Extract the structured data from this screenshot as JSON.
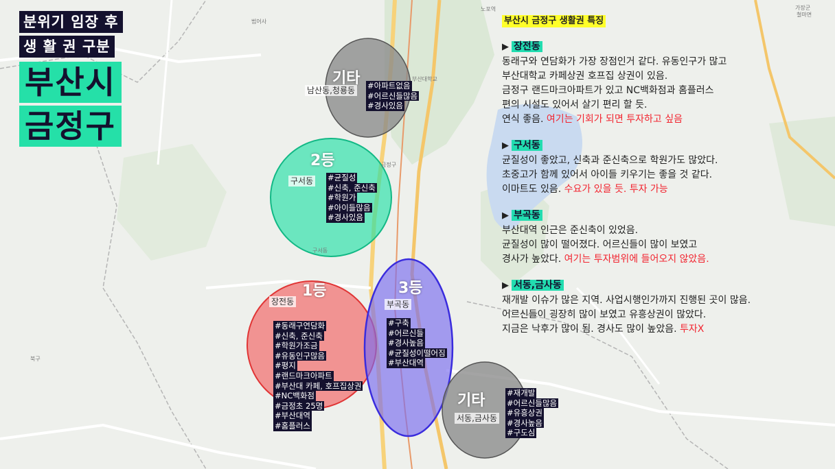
{
  "colors": {
    "title_bg": "#14112e",
    "title_big_bg": "#25e0a8",
    "grade_etc": "#8a8a8a",
    "grade_2": "#25e0a8",
    "grade_1": "#f25a5a",
    "grade_3": "#7a6cf0",
    "highlight": "#ffff2a",
    "section_bg": "#22ddb0",
    "accent_red": "#f2242f"
  },
  "title": {
    "line1": "분위기 임장 후",
    "line2": "생 활 권 구분",
    "big1": "부산시",
    "big2": "금정구"
  },
  "map_labels": {
    "l1": "범어사",
    "l2": "노포역",
    "l3": "가장군",
    "l4": "철마면",
    "l5": "금정구",
    "l6": "서동",
    "l7": "북구",
    "l8": "부산대학교",
    "l9": "청룡동",
    "l10": "구서동"
  },
  "zones": [
    {
      "rank": "기타",
      "area": "남산동,청룡동",
      "tags": [
        "#아파트없음",
        "#어르신들많음",
        "#경사있음"
      ]
    },
    {
      "rank": "2등",
      "area": "구서동",
      "tags": [
        "#균질성",
        "#신축, 준신축",
        "#학원가",
        "#아이들많음",
        "#경사있음"
      ]
    },
    {
      "rank": "1등",
      "area": "장전동",
      "tags": [
        "#동래구연담화",
        "#신축, 준신축",
        "#학원가조금",
        "#유동인구많음",
        "#평지",
        "#랜드마크아파트",
        "#부산대 카페, 호프집상권",
        "#NC백화점",
        "#금정초 25명",
        "#부산대역",
        "#홈플러스"
      ]
    },
    {
      "rank": "3등",
      "area": "부곡동",
      "tags": [
        "#구축",
        "#어르신들",
        "#경사높음",
        "#균질성이떨어짐",
        "#부산대역"
      ]
    },
    {
      "rank": "기타",
      "area": "서동,금사동",
      "tags": [
        "#재개발",
        "#어르신들많음",
        "#유흥상권",
        "#경사높음",
        "#구도심"
      ]
    }
  ],
  "panel": {
    "title": "부산시 금정구 생활권 특징",
    "arrow": "▶",
    "sections": [
      {
        "name": "장전동",
        "lines": [
          "동래구와 연담화가 가장 장점인거 같다. 유동인구가 많고",
          "부산대학교 카페상권 호프집 상권이 있음.",
          "금정구 랜드마크아파트가 있고 NC백화점과 홈플러스",
          "편의 시설도 있어서 살기 편리 할 듯."
        ],
        "last_normal": "연식 좋음. ",
        "last_accent": "여기는 기회가 되면 투자하고 싶음"
      },
      {
        "name": "구서동",
        "lines": [
          "균질성이 좋았고, 신축과 준신축으로 학원가도 많았다.",
          "초중고가 함께 있어서 아이들 키우기는 좋을 것 같다."
        ],
        "last_normal": "이마트도 있음. ",
        "last_accent": "수요가 있을 듯. 투자 가능"
      },
      {
        "name": "부곡동",
        "lines": [
          "부산대역 인근은 준신축이 있었음.",
          "균질성이 많이 떨어졌다. 어르신들이 많이 보였고"
        ],
        "last_normal": "경사가 높았다. ",
        "last_accent": "여기는 투자범위에 들어오지 않았음."
      },
      {
        "name": "서동,금사동",
        "lines": [
          "재개발 이슈가 많은 지역. 사업시행인가까지 진행된 곳이 많음.",
          "어르신들이 굉장히 많이 보였고 유흥상권이 많았다."
        ],
        "last_normal": "지금은 낙후가 많이 됨. 경사도 많이 높았음. ",
        "last_accent": "투자X"
      }
    ]
  }
}
